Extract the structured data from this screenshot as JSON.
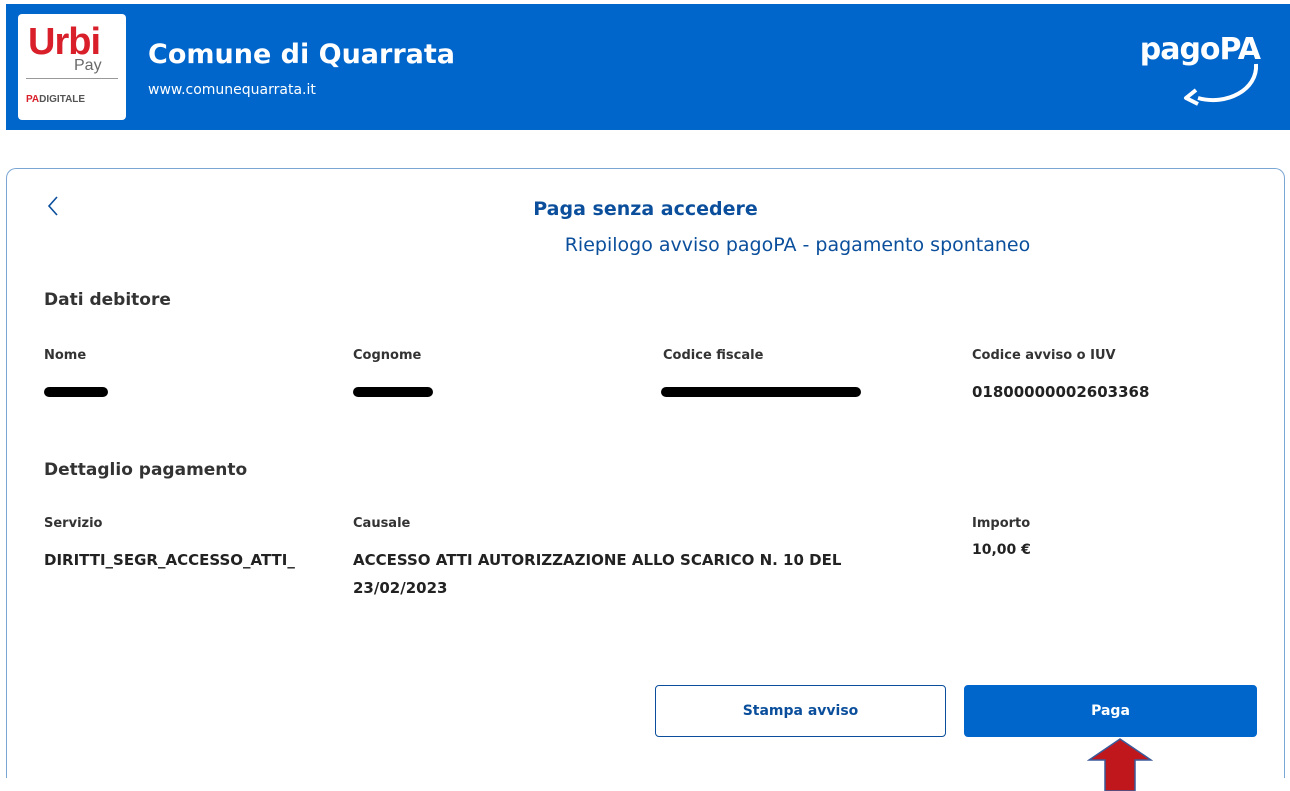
{
  "header": {
    "logo": {
      "brand": "Urbi",
      "brand_sub": "Pay",
      "tagline_pa": "PA",
      "tagline_rest": "DIGITALE"
    },
    "title": "Comune di Quarrata",
    "url": "www.comunequarrata.it",
    "pagopa_logo": "pagoPA"
  },
  "card": {
    "back_icon": "chevron-left-icon",
    "title": "Paga senza accedere",
    "subtitle": "Riepilogo avviso pagoPA - pagamento spontaneo",
    "debtor": {
      "heading": "Dati debitore",
      "fields": [
        {
          "label": "Nome",
          "value_redacted": true
        },
        {
          "label": "Cognome",
          "value_redacted": true
        },
        {
          "label": "Codice fiscale",
          "value_redacted": true
        },
        {
          "label": "Codice avviso o IUV",
          "value": "01800000002603368"
        }
      ]
    },
    "payment": {
      "heading": "Dettaglio pagamento",
      "servizio_label": "Servizio",
      "servizio_value": "DIRITTI_SEGR_ACCESSO_ATTI_",
      "causale_label": "Causale",
      "causale_line1": "ACCESSO ATTI AUTORIZZAZIONE ALLO SCARICO N. 10 DEL",
      "causale_line2": "23/02/2023",
      "importo_label": "Importo",
      "importo_value": "10,00 €"
    },
    "actions": {
      "print_label": "Stampa avviso",
      "pay_label": "Paga"
    }
  },
  "colors": {
    "header_bg": "#0066cc",
    "primary_text": "#0b4f9c",
    "brand_red": "#d81f2a",
    "annotation_arrow": "#c0171c"
  }
}
